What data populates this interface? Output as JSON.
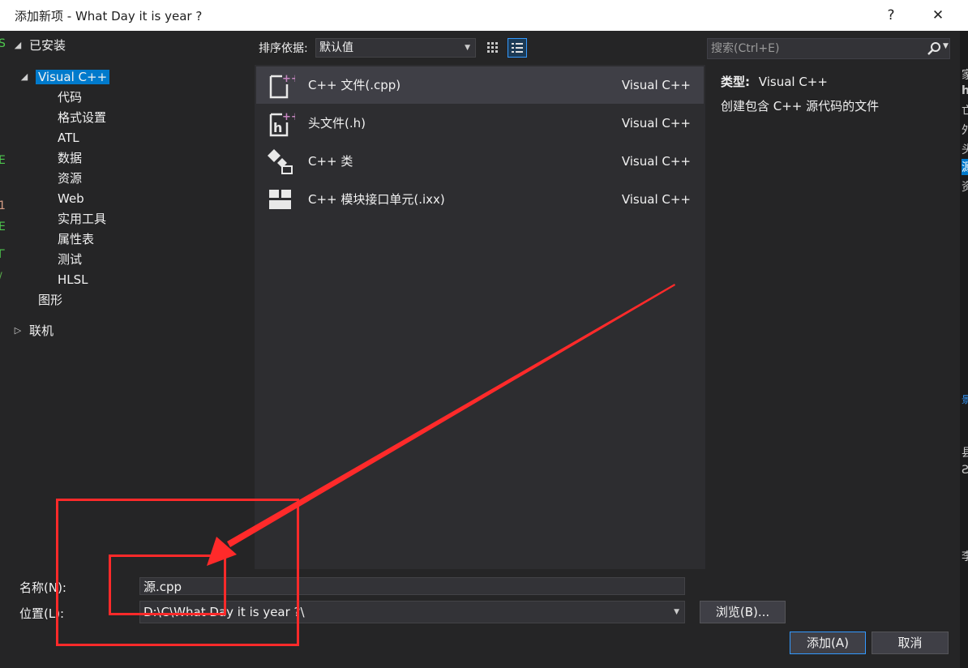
{
  "window": {
    "title": "添加新项 - What Day it is year ?",
    "help_glyph": "?",
    "close_glyph": "✕"
  },
  "tree": {
    "installed_label": "已安装",
    "visual_cpp": "Visual C++",
    "children": [
      "代码",
      "格式设置",
      "ATL",
      "数据",
      "资源",
      "Web",
      "实用工具",
      "属性表",
      "测试",
      "HLSL"
    ],
    "graphics": "图形",
    "online": "联机"
  },
  "toolbar": {
    "sort_label": "排序依据:",
    "sort_value": "默认值",
    "search_placeholder": "搜索(Ctrl+E)"
  },
  "templates": [
    {
      "name": "C++ 文件(.cpp)",
      "lang": "Visual C++",
      "icon": "cpp-file-icon",
      "selected": true
    },
    {
      "name": "头文件(.h)",
      "lang": "Visual C++",
      "icon": "header-file-icon",
      "selected": false
    },
    {
      "name": "C++ 类",
      "lang": "Visual C++",
      "icon": "class-icon",
      "selected": false
    },
    {
      "name": "C++ 模块接口单元(.ixx)",
      "lang": "Visual C++",
      "icon": "module-icon",
      "selected": false
    }
  ],
  "info": {
    "type_label": "类型:",
    "type_value": "Visual C++",
    "description": "创建包含 C++ 源代码的文件"
  },
  "form": {
    "name_label": "名称(N):",
    "name_value": "源.cpp",
    "location_label": "位置(L):",
    "location_value": "D:\\C\\What Day it is year ?\\",
    "browse_label": "浏览(B)...",
    "add_label": "添加(A)",
    "cancel_label": "取消"
  },
  "background_fragments": {
    "left": [
      "S",
      "E",
      "1",
      "E",
      "Г",
      "/"
    ],
    "right": [
      "家",
      "ha",
      "亡",
      "外",
      "头",
      "源",
      "资",
      "景",
      "县",
      "Ƨ",
      "李"
    ]
  },
  "colors": {
    "accent": "#007acc",
    "annotation": "#ff2a2a",
    "icon_accent": "#c586c0"
  }
}
